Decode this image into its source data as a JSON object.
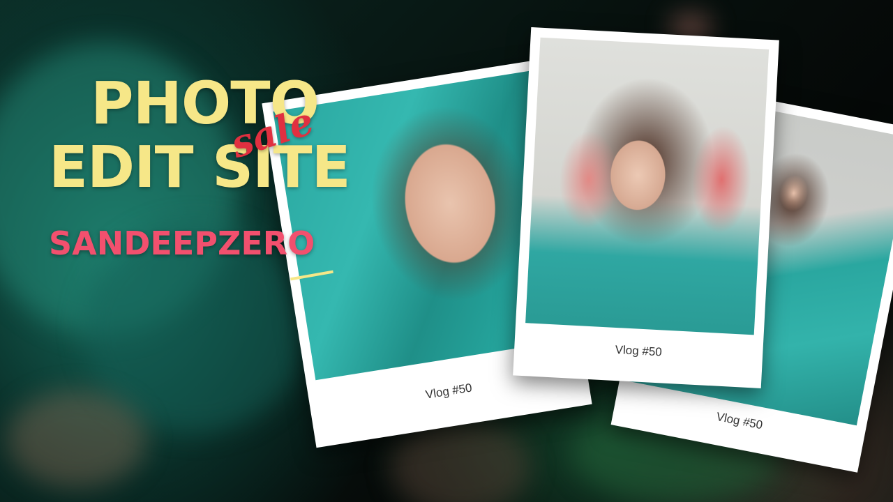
{
  "headline": {
    "line1": "PHOTO",
    "line2": "EDIT SITE",
    "accent": "sale",
    "brand": "SANDEEPZERO"
  },
  "colors": {
    "headline": "#f6e788",
    "accent": "#e03040",
    "brand": "#f2506e"
  },
  "cards": [
    {
      "caption": "Vlog #50",
      "image": "woman-with-holi-colors-teal-saree-photo"
    },
    {
      "caption": "Vlog #50",
      "image": "woman-raising-painted-hands-photo"
    },
    {
      "caption": "Vlog #50",
      "image": "woman-in-teal-saree-posing-photo"
    }
  ]
}
